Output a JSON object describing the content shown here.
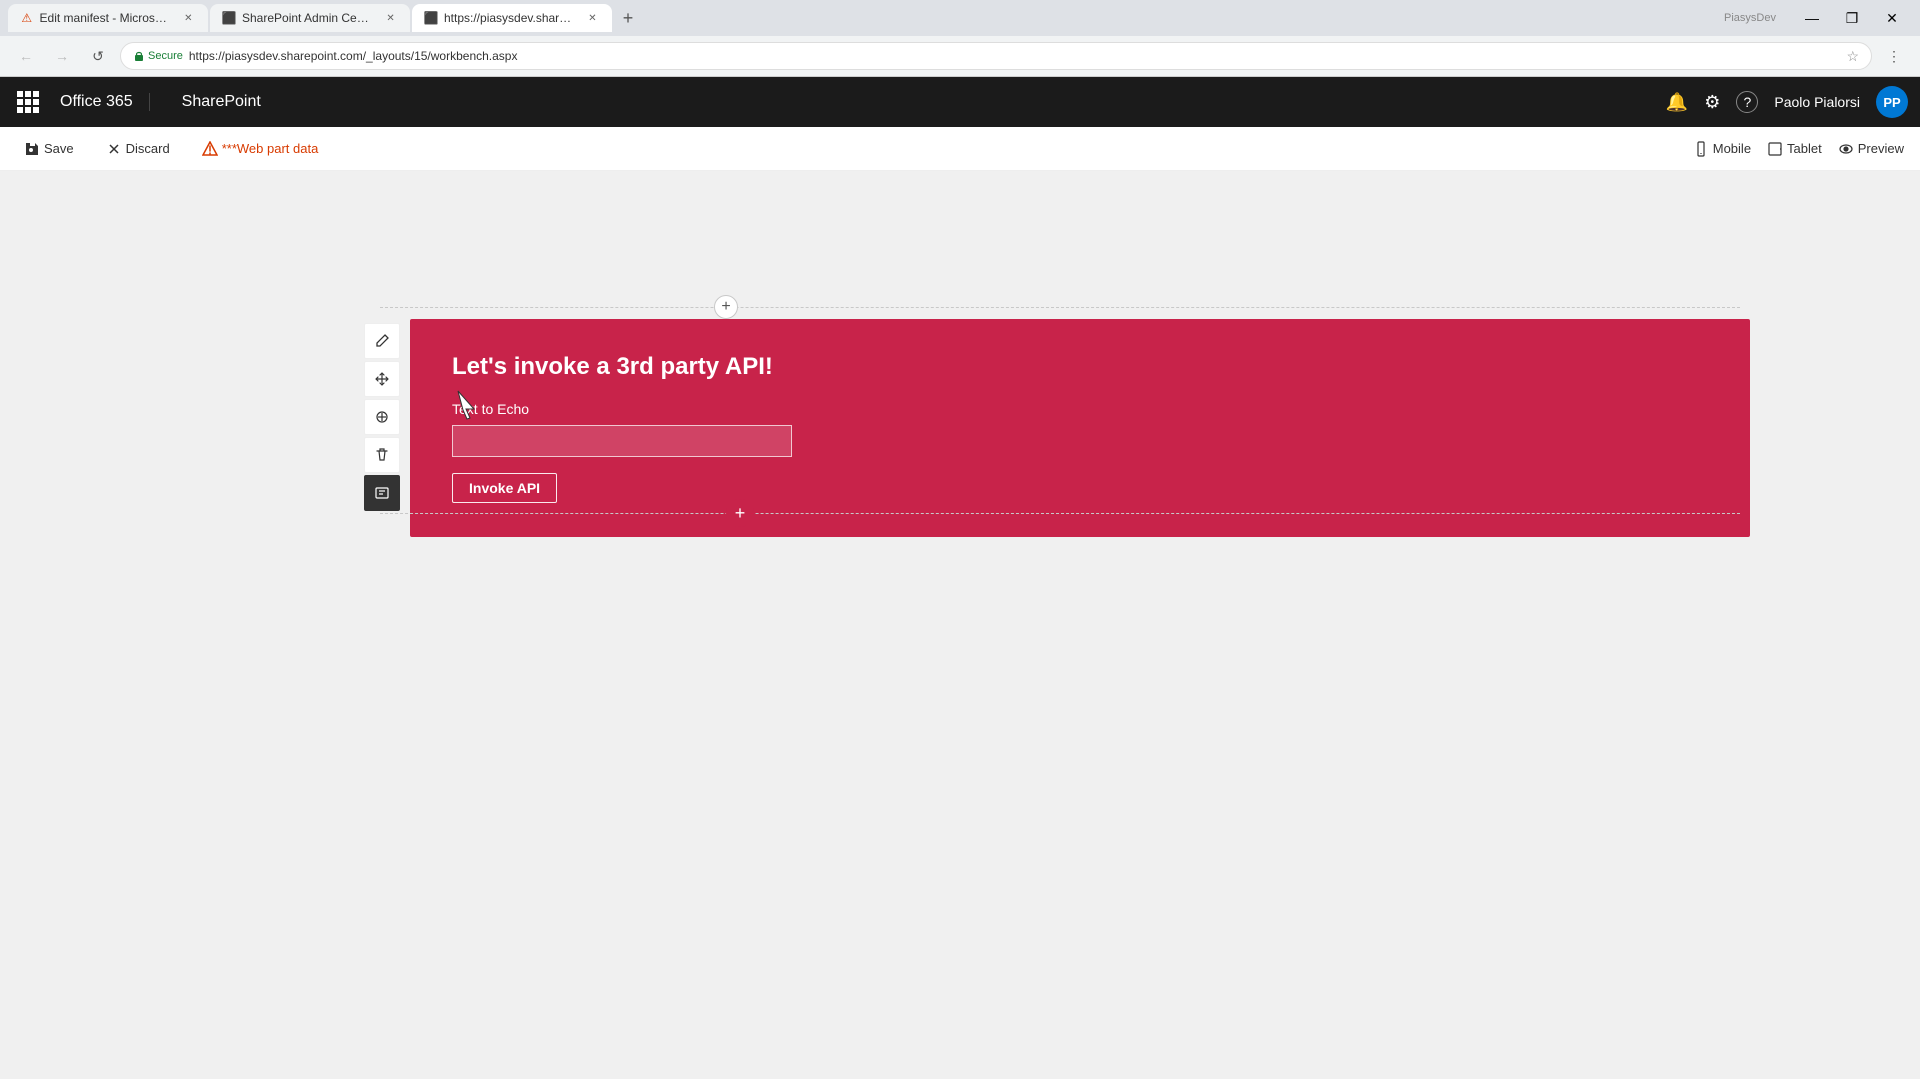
{
  "browser": {
    "tabs": [
      {
        "id": "tab1",
        "title": "Edit manifest - Microsof...",
        "favicon": "⚠",
        "active": false
      },
      {
        "id": "tab2",
        "title": "SharePoint Admin Cente...",
        "favicon": "🟦",
        "active": false
      },
      {
        "id": "tab3",
        "title": "https://piasysdev.sharep...",
        "favicon": "🟦",
        "active": true
      }
    ],
    "address": {
      "secure_label": "Secure",
      "url": "https://piasysdev.sharepoint.com/_layouts/15/workbench.aspx"
    },
    "piasysdev_label": "PiasysDev",
    "win_minimize": "—",
    "win_restore": "❐",
    "win_close": "✕"
  },
  "o365": {
    "app_title": "Office 365",
    "product_title": "SharePoint",
    "user_name": "Paolo Pialorsi",
    "user_initials": "PP"
  },
  "toolbar": {
    "save_label": "Save",
    "discard_label": "Discard",
    "webpart_data_label": "***Web part data",
    "mobile_label": "Mobile",
    "tablet_label": "Tablet",
    "preview_label": "Preview"
  },
  "webpart": {
    "title": "Let's invoke a 3rd party API!",
    "text_echo_label": "Text to Echo",
    "text_echo_value": "",
    "invoke_button_label": "Invoke API"
  },
  "icons": {
    "waffle": "⊞",
    "bell": "🔔",
    "gear": "⚙",
    "help": "?",
    "pencil": "✏",
    "move": "⊕",
    "delete": "🗑",
    "copy": "⧉",
    "add": "+",
    "mobile": "📱",
    "tablet": "▭",
    "eye": "👁"
  }
}
